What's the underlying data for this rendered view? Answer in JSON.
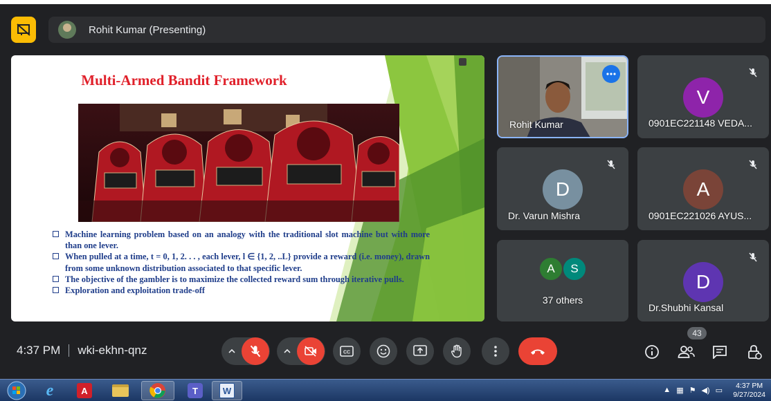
{
  "presenter": {
    "name": "Rohit Kumar (Presenting)"
  },
  "slide": {
    "title": "Multi-Armed Bandit Framework",
    "image_label": "slot machines photo",
    "bullets": [
      "Machine learning problem based on an analogy with the traditional slot machine but with more than one lever.",
      "When pulled at a time, t = 0, 1, 2. . . , each lever, l ∈ {1, 2, ..L} provide a reward (i.e. money), drawn from some unknown distribution associated to that specific lever.",
      "The objective of the gambler is to maximize the collected reward sum through iterative pulls.",
      "Exploration and exploitation trade-off"
    ]
  },
  "tiles": {
    "rohit": {
      "name": "Rohit Kumar"
    },
    "veda": {
      "initial": "V",
      "name": "0901EC221148 VEDA...",
      "color": "#8e24aa"
    },
    "varun": {
      "initial": "D",
      "name": "Dr. Varun Mishra",
      "color": "#7890a0"
    },
    "ayus": {
      "initial": "A",
      "name": "0901EC221026 AYUS...",
      "color": "#7a4438"
    },
    "others": {
      "a": "A",
      "s": "S",
      "label": "37 others"
    },
    "shubhi": {
      "initial": "D",
      "name": "Dr.Shubhi Kansal",
      "color": "#5e35b1"
    }
  },
  "controls": {
    "time": "4:37 PM",
    "meeting_code": "wki-ekhn-qnz",
    "participant_count": "43"
  },
  "taskbar": {
    "time": "4:37 PM",
    "date": "9/27/2024"
  },
  "colors": {
    "accent_red": "#ea4335",
    "present_yellow": "#fbbc04",
    "active_blue": "#8ab4f8"
  }
}
